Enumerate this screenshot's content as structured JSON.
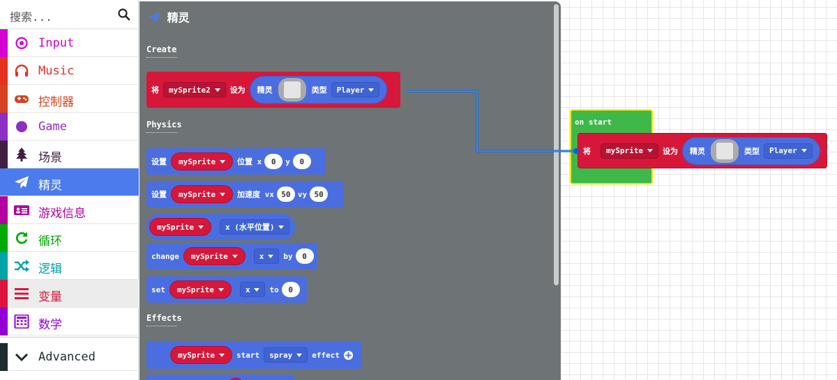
{
  "search": {
    "placeholder": "搜索..."
  },
  "categories": [
    {
      "label": "Input",
      "color": "#d400d4",
      "icon": "circle-dot-icon"
    },
    {
      "label": "Music",
      "color": "#e63022",
      "icon": "headphones-icon"
    },
    {
      "label": "控制器",
      "color": "#d54322",
      "icon": "gamepad-icon"
    },
    {
      "label": "Game",
      "color": "#8e2ec4",
      "icon": "circle-icon"
    },
    {
      "label": "场景",
      "color": "#401f40",
      "icon": "tree-icon"
    },
    {
      "label": "精灵",
      "color": "#4b7bec",
      "icon": "paper-plane-icon"
    },
    {
      "label": "游戏信息",
      "color": "#b4009e",
      "icon": "id-card-icon"
    },
    {
      "label": "循环",
      "color": "#00aa00",
      "icon": "refresh-icon"
    },
    {
      "label": "逻辑",
      "color": "#00a4a6",
      "icon": "shuffle-icon"
    },
    {
      "label": "变量",
      "color": "#dc143c",
      "icon": "list-icon"
    },
    {
      "label": "数学",
      "color": "#9400d3",
      "icon": "calculator-icon"
    }
  ],
  "advanced": {
    "label": "Advanced",
    "color": "#1e2b2f"
  },
  "flyout": {
    "title": "精灵",
    "sections": {
      "create": "Create",
      "physics": "Physics",
      "effects": "Effects"
    },
    "create_block": {
      "set": "将",
      "var": "mySprite2",
      "to": "设为",
      "sprite": "精灵",
      "kind_label": "类型",
      "kind": "Player"
    },
    "pos_block": {
      "set": "设置",
      "var": "mySprite",
      "label": "位置 x",
      "y": "y",
      "x_val": "0",
      "y_val": "0"
    },
    "acc_block": {
      "set": "设置",
      "var": "mySprite",
      "label": "加速度 vx",
      "vy": "vy",
      "vx_val": "50",
      "vy_val": "50"
    },
    "prop_block": {
      "var": "mySprite",
      "prop": "x (水平位置)"
    },
    "change_block": {
      "change": "change",
      "var": "mySprite",
      "prop": "x",
      "by": "by",
      "val": "0"
    },
    "setprop_block": {
      "set": "set",
      "var": "mySprite",
      "prop": "x",
      "to": "to",
      "val": "0"
    },
    "effect_block": {
      "var": "mySprite",
      "start": "start",
      "effect": "spray",
      "label": "effect"
    }
  },
  "workspace": {
    "on_start": "on start",
    "block": {
      "set": "将",
      "var": "mySprite",
      "to": "设为",
      "sprite": "精灵",
      "kind_label": "类型",
      "kind": "Player"
    }
  }
}
